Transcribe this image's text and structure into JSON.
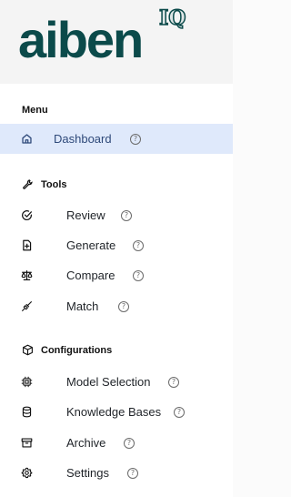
{
  "brand": {
    "name": "aiben",
    "suffix": "IQ"
  },
  "sidebar": {
    "menu_header": "Menu",
    "dashboard": {
      "label": "Dashboard",
      "icon": "home-icon",
      "active": true
    },
    "tools_header": "Tools",
    "tools": [
      {
        "label": "Review",
        "icon": "check-circle-icon"
      },
      {
        "label": "Generate",
        "icon": "file-plus-icon"
      },
      {
        "label": "Compare",
        "icon": "scale-icon"
      },
      {
        "label": "Match",
        "icon": "plug-icon"
      }
    ],
    "config_header": "Configurations",
    "configurations": [
      {
        "label": "Model Selection",
        "icon": "chip-icon"
      },
      {
        "label": "Knowledge Bases",
        "icon": "database-icon"
      },
      {
        "label": "Archive",
        "icon": "archive-icon"
      },
      {
        "label": "Settings",
        "icon": "gear-icon"
      }
    ],
    "help_glyph": "?"
  },
  "colors": {
    "brand": "#0b4a4a",
    "active_bg": "#dfe9fb",
    "active_text": "#2f4a7a"
  }
}
